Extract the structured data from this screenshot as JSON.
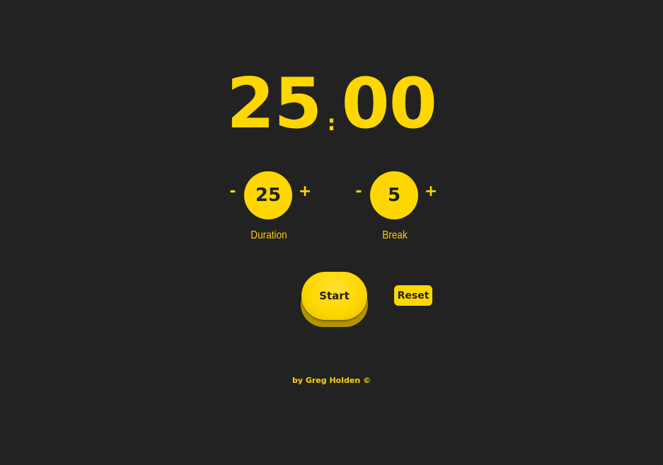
{
  "timer": {
    "minutes": "25",
    "separator": ":",
    "seconds": "00"
  },
  "duration": {
    "decrement_label": "-",
    "value": "25",
    "increment_label": "+",
    "label": "Duration"
  },
  "break": {
    "decrement_label": "-",
    "value": "5",
    "increment_label": "+",
    "label": "Break"
  },
  "controls": {
    "start_label": "Start",
    "reset_label": "Reset"
  },
  "footer": {
    "credit": "by Greg Holden ©"
  },
  "colors": {
    "background": "#222222",
    "accent": "#ffd700",
    "text_dark": "#222222"
  }
}
